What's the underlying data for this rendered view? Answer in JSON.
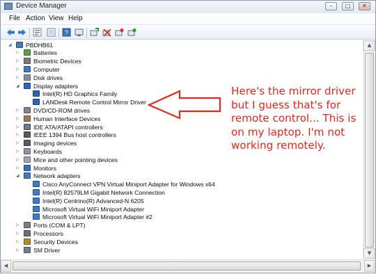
{
  "window": {
    "title": "Device Manager",
    "controls": {
      "minimize": "–",
      "maximize": "□",
      "close": "✕"
    }
  },
  "menu": [
    "File",
    "Action",
    "View",
    "Help"
  ],
  "toolbar_icons": [
    "back-arrow-icon",
    "forward-arrow-icon",
    "properties-icon",
    "show-hide-icon",
    "help-icon",
    "scan-icon",
    "update-driver-icon",
    "uninstall-icon",
    "disable-icon",
    "enable-icon"
  ],
  "tree": {
    "root": "PBDHB61",
    "items": [
      {
        "label": "Batteries",
        "level": 1,
        "expanded": false,
        "icon": "battery-icon"
      },
      {
        "label": "Biometric Devices",
        "level": 1,
        "expanded": false,
        "icon": "biometric-icon"
      },
      {
        "label": "Computer",
        "level": 1,
        "expanded": false,
        "icon": "computer-icon"
      },
      {
        "label": "Disk drives",
        "level": 1,
        "expanded": false,
        "icon": "disk-icon"
      },
      {
        "label": "Display adapters",
        "level": 1,
        "expanded": true,
        "icon": "display-icon"
      },
      {
        "label": "Intel(R) HD Graphics Family",
        "level": 2,
        "icon": "display-icon"
      },
      {
        "label": "LANDesk Remote Control Mirror Driver",
        "level": 2,
        "icon": "display-icon"
      },
      {
        "label": "DVD/CD-ROM drives",
        "level": 1,
        "expanded": false,
        "icon": "dvd-icon"
      },
      {
        "label": "Human Interface Devices",
        "level": 1,
        "expanded": false,
        "icon": "hid-icon"
      },
      {
        "label": "IDE ATA/ATAPI controllers",
        "level": 1,
        "expanded": false,
        "icon": "ide-icon"
      },
      {
        "label": "IEEE 1394 Bus host controllers",
        "level": 1,
        "expanded": false,
        "icon": "ieee-icon"
      },
      {
        "label": "Imaging devices",
        "level": 1,
        "expanded": false,
        "icon": "camera-icon"
      },
      {
        "label": "Keyboards",
        "level": 1,
        "expanded": false,
        "icon": "keyboard-icon"
      },
      {
        "label": "Mice and other pointing devices",
        "level": 1,
        "expanded": false,
        "icon": "mouse-icon"
      },
      {
        "label": "Monitors",
        "level": 1,
        "expanded": false,
        "icon": "monitor-icon"
      },
      {
        "label": "Network adapters",
        "level": 1,
        "expanded": true,
        "icon": "network-icon"
      },
      {
        "label": "Cisco AnyConnect VPN Virtual Miniport Adapter for Windows x64",
        "level": 2,
        "icon": "network-icon"
      },
      {
        "label": "Intel(R) 82579LM Gigabit Network Connection",
        "level": 2,
        "icon": "network-icon"
      },
      {
        "label": "Intel(R) Centrino(R) Advanced-N 6205",
        "level": 2,
        "icon": "network-icon"
      },
      {
        "label": "Microsoft Virtual WiFi Miniport Adapter",
        "level": 2,
        "icon": "network-icon"
      },
      {
        "label": "Microsoft Virtual WiFi Miniport Adapter #2",
        "level": 2,
        "icon": "network-icon"
      },
      {
        "label": "Ports (COM & LPT)",
        "level": 1,
        "expanded": false,
        "icon": "port-icon"
      },
      {
        "label": "Processors",
        "level": 1,
        "expanded": false,
        "icon": "processor-icon"
      },
      {
        "label": "Security Devices",
        "level": 1,
        "expanded": false,
        "icon": "security-icon"
      },
      {
        "label": "SM Driver",
        "level": 1,
        "expanded": false,
        "icon": "sm-driver-icon"
      }
    ]
  },
  "annotation": {
    "lines": [
      "Here's the mirror driver",
      "but I guess that's for",
      "remote control... This is",
      "on my laptop. I'm not",
      "working remotely."
    ],
    "color": "#e0291f"
  },
  "scroll": {
    "up": "▲",
    "down": "▼",
    "left": "◀",
    "right": "▶"
  }
}
